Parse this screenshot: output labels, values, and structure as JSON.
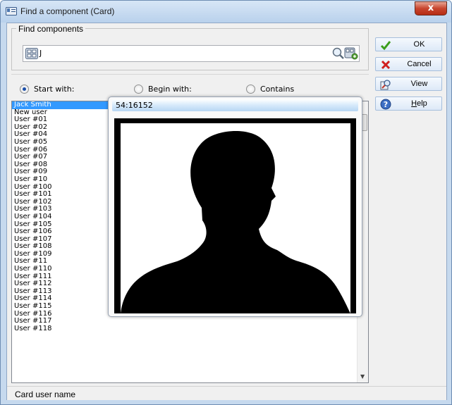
{
  "window": {
    "title": "Find a component (Card)",
    "close_label": "x"
  },
  "find": {
    "group_label": "Find components",
    "search_value": "J"
  },
  "search_mode": {
    "options": [
      "Start with:",
      "Begin with:",
      "Contains"
    ],
    "selected": "Start with:"
  },
  "list": {
    "items": [
      "Jack Smith",
      "New user",
      "User #01",
      "User #02",
      "User #04",
      "User #05",
      "User #06",
      "User #07",
      "User #08",
      "User #09",
      "User #10",
      "User #100",
      "User #101",
      "User #102",
      "User #103",
      "User #104",
      "User #105",
      "User #106",
      "User #107",
      "User #108",
      "User #109",
      "User #11",
      "User #110",
      "User #111",
      "User #112",
      "User #113",
      "User #114",
      "User #115",
      "User #116",
      "User #117",
      "User #118"
    ],
    "selected_index": 0
  },
  "popup": {
    "card_number": "54:16152"
  },
  "buttons": {
    "ok": "OK",
    "cancel": "Cancel",
    "view": "View",
    "help_underline": "H",
    "help_rest": "elp"
  },
  "status": {
    "text": "Card user name"
  },
  "colors": {
    "accent": "#3399ff",
    "ok_icon": "#3a9d1b",
    "cancel_icon": "#d01f1f"
  }
}
